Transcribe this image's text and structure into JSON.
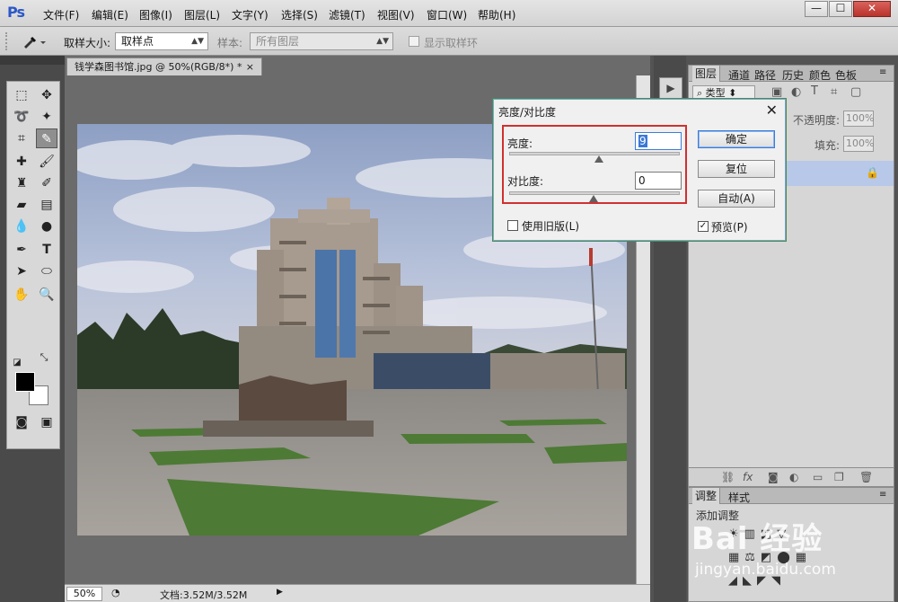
{
  "app": {
    "logo": "Ps"
  },
  "menu": [
    "文件(F)",
    "编辑(E)",
    "图像(I)",
    "图层(L)",
    "文字(Y)",
    "选择(S)",
    "滤镜(T)",
    "视图(V)",
    "窗口(W)",
    "帮助(H)"
  ],
  "window_controls": {
    "minimize": "—",
    "restore": "☐",
    "close": "✕"
  },
  "options": {
    "sample_size_label": "取样大小:",
    "sample_size_value": "取样点",
    "sample_label": "样本:",
    "sample_value": "所有图层",
    "show_ring_label": "显示取样环"
  },
  "document": {
    "tab_title": "钱学森图书馆.jpg @ 50%(RGB/8*) *",
    "tab_close": "×",
    "zoom": "50%",
    "doc_info": "文档:3.52M/3.52M",
    "status_arrow": "▶"
  },
  "panels": {
    "tabs": [
      "图层",
      "通道",
      "路径",
      "历史",
      "颜色",
      "色板"
    ],
    "filter_kind": "类型",
    "opacity_label": "不透明度:",
    "opacity_value": "100%",
    "fill_label": "填充:",
    "fill_value": "100%",
    "adjust_tabs": [
      "调整",
      "样式"
    ],
    "add_adjustment": "添加调整"
  },
  "dialog": {
    "title": "亮度/对比度",
    "close": "✕",
    "brightness_label": "亮度:",
    "brightness_value": "9",
    "contrast_label": "对比度:",
    "contrast_value": "0",
    "ok": "确定",
    "reset": "复位",
    "auto": "自动(A)",
    "legacy_label": "使用旧版(L)",
    "preview_label": "预览(P)",
    "legacy_checked": false,
    "preview_checked": true
  },
  "watermark": {
    "brand": "Bai 经验",
    "url": "jingyan.baidu.com"
  }
}
